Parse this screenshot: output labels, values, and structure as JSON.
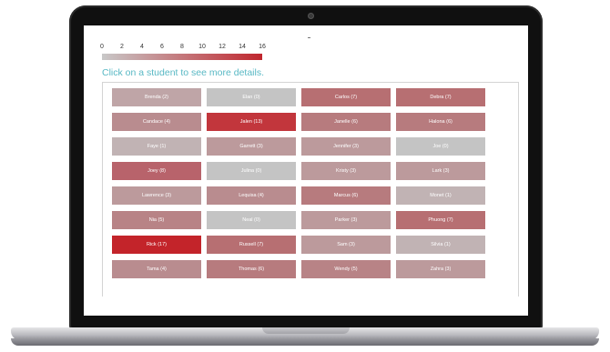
{
  "legend": {
    "ticks": [
      "0",
      "2",
      "4",
      "6",
      "8",
      "10",
      "12",
      "14",
      "16"
    ],
    "min_color": "#c8c8c8",
    "max_color": "#c0262e"
  },
  "instruction": "Click on a student to see more details.",
  "students": [
    {
      "name": "Brenda (2)",
      "color": "#bfa5a7"
    },
    {
      "name": "Elan (0)",
      "color": "#c4c4c4"
    },
    {
      "name": "Carlos (7)",
      "color": "#b76f72"
    },
    {
      "name": "Debra (7)",
      "color": "#b76f72"
    },
    {
      "name": "Candace (4)",
      "color": "#b98c8f"
    },
    {
      "name": "Jalen (13)",
      "color": "#c2363c"
    },
    {
      "name": "Janelle (6)",
      "color": "#b77b7e"
    },
    {
      "name": "Halona (6)",
      "color": "#b77b7e"
    },
    {
      "name": "Faye (1)",
      "color": "#c1b3b4"
    },
    {
      "name": "Garrett (3)",
      "color": "#bc9a9c"
    },
    {
      "name": "Jennifer (3)",
      "color": "#bc9a9c"
    },
    {
      "name": "Joe (0)",
      "color": "#c4c4c4"
    },
    {
      "name": "Joey (8)",
      "color": "#b8636b"
    },
    {
      "name": "Julina (0)",
      "color": "#c4c4c4"
    },
    {
      "name": "Kristy (3)",
      "color": "#bc9a9c"
    },
    {
      "name": "Lark (3)",
      "color": "#bc9a9c"
    },
    {
      "name": "Lawrence (3)",
      "color": "#bc9a9c"
    },
    {
      "name": "Lequisa (4)",
      "color": "#b98c8f"
    },
    {
      "name": "Marcus (6)",
      "color": "#b77b7e"
    },
    {
      "name": "Monet (1)",
      "color": "#c1b3b4"
    },
    {
      "name": "Nia (5)",
      "color": "#b88386"
    },
    {
      "name": "Neal (0)",
      "color": "#c4c4c4"
    },
    {
      "name": "Parker (3)",
      "color": "#bc9a9c"
    },
    {
      "name": "Phuong (7)",
      "color": "#b76f72"
    },
    {
      "name": "Rick (17)",
      "color": "#c3242a"
    },
    {
      "name": "Russell (7)",
      "color": "#b76f72"
    },
    {
      "name": "Sam (3)",
      "color": "#bc9a9c"
    },
    {
      "name": "Silvia (1)",
      "color": "#c1b3b4"
    },
    {
      "name": "Tama (4)",
      "color": "#b98c8f"
    },
    {
      "name": "Thomas (6)",
      "color": "#b77b7e"
    },
    {
      "name": "Wendy (5)",
      "color": "#b88386"
    },
    {
      "name": "Zahra (3)",
      "color": "#bc9a9c"
    }
  ]
}
